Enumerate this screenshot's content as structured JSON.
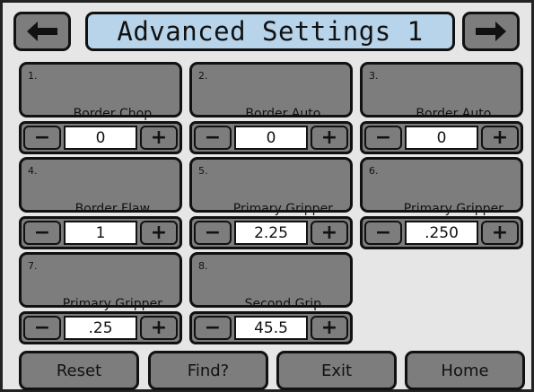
{
  "header": {
    "title": "Advanced Settings 1",
    "prev_icon": "arrow-left-icon",
    "next_icon": "arrow-right-icon"
  },
  "settings": [
    {
      "num": "1.",
      "label": "Border Chop\nPause Enable",
      "value": "0"
    },
    {
      "num": "2.",
      "label": "Border Auto\nFlaw Mark Enable",
      "value": "0"
    },
    {
      "num": "3.",
      "label": "Border Auto\nSplice Enable",
      "value": "0"
    },
    {
      "num": "4.",
      "label": "Border Flaw\nMark Enable",
      "value": "1"
    },
    {
      "num": "5.",
      "label": "Primary Gripper\nDistance",
      "value": "2.25"
    },
    {
      "num": "6.",
      "label": "Primary Gripper\nClose Time",
      "value": ".250"
    },
    {
      "num": "7.",
      "label": "Primary Gripper\nOut Time",
      "value": ".25"
    },
    {
      "num": "8.",
      "label": "Second Grip\nOut Distance",
      "value": "45.5"
    }
  ],
  "stepper": {
    "minus_label": "−",
    "plus_label": "+"
  },
  "footer": {
    "reset": "Reset",
    "find": "Find?",
    "exit": "Exit",
    "home": "Home"
  },
  "colors": {
    "button": "#7d7d7d",
    "title_bg": "#b8d4ea",
    "background": "#e6e6e6",
    "value_bg": "#ffffff"
  }
}
